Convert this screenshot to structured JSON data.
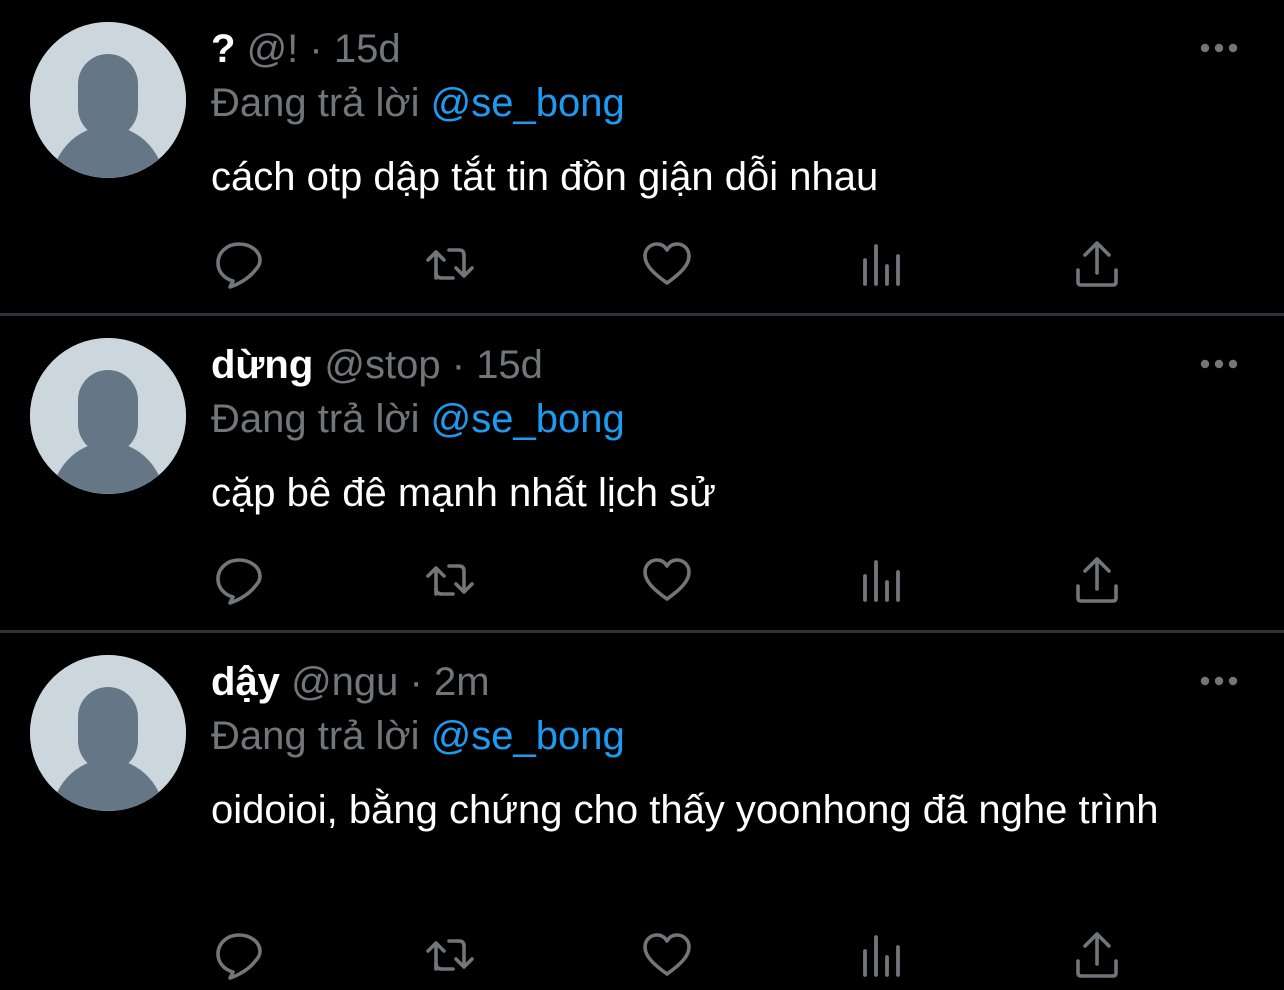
{
  "colors": {
    "background": "#000000",
    "divider": "#2f3336",
    "primary_text": "#ffffff",
    "secondary_text": "#71767b",
    "accent": "#1d9bf0",
    "avatar_bg": "#ccd6dd",
    "avatar_figure": "#657786"
  },
  "icons": {
    "more": "more-horizontal-icon",
    "reply": "reply-bubble-icon",
    "retweet": "retweet-icon",
    "like": "heart-icon",
    "views": "analytics-bars-icon",
    "share": "share-upload-icon",
    "avatar": "default-profile-avatar"
  },
  "tweets": [
    {
      "name": "?",
      "handle": "@!",
      "separator": "·",
      "time": "15d",
      "replying_prefix": "Đang trả lời",
      "replying_to": "@se_bong",
      "text": "cách otp dập tắt tin đồn giận dỗi nhau"
    },
    {
      "name": "dừng",
      "handle": "@stop",
      "separator": "·",
      "time": "15d",
      "replying_prefix": "Đang trả lời",
      "replying_to": "@se_bong",
      "text": "cặp bê đê mạnh nhất lịch sử"
    },
    {
      "name": "dậy",
      "handle": "@ngu",
      "separator": "·",
      "time": "2m",
      "replying_prefix": "Đang trả lời",
      "replying_to": "@se_bong",
      "text": "oidoioi, bằng chứng cho thấy yoonhong đã nghe trình"
    }
  ]
}
